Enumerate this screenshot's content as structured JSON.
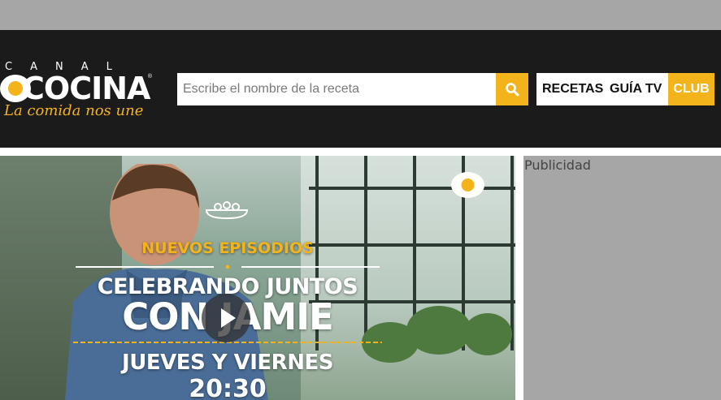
{
  "colors": {
    "accent": "#f3b41b",
    "header_bg": "#1b1b1b",
    "ad_bg": "#a6a6a6"
  },
  "logo": {
    "brand_top": "CANAL",
    "brand_main": "COCINA",
    "registered": "®",
    "tagline": "La comida nos une"
  },
  "search": {
    "placeholder": "Escribe el nombre de la receta",
    "icon": "search-icon"
  },
  "nav": {
    "recetas": "RECETAS",
    "guia_tv": "GUÍA TV",
    "club": "CLUB"
  },
  "video": {
    "label_new": "NUEVOS EPISODIOS",
    "title_line1": "CELEBRANDO JUNTOS",
    "title_line2": "CON JAMIE",
    "days": "JUEVES Y VIERNES",
    "time": "20:30",
    "play_icon": "play-icon"
  },
  "ad": {
    "label": "Publicidad"
  }
}
